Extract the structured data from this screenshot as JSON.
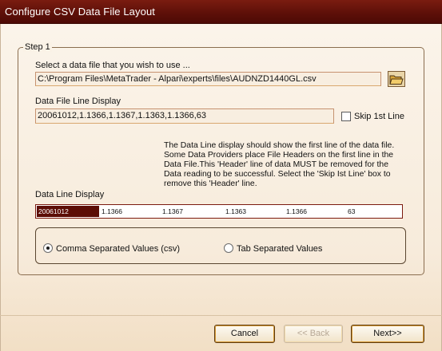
{
  "window": {
    "title": "Configure CSV Data File Layout"
  },
  "step": {
    "legend": "Step 1",
    "select_label": "Select a data file that you wish to use ...",
    "file_path": "C:\\Program Files\\MetaTrader - Alpari\\experts\\files\\AUDNZD1440GL.csv",
    "line_display_label": "Data File Line Display",
    "line_display_value": "20061012,1.1366,1.1367,1.1363,1.1366,63",
    "skip_label": "Skip 1st Line",
    "skip_checked": false,
    "info_lines": [
      "The Data Line display should show the first line of the data file.",
      "Some Data Providers place File Headers on the first line in the",
      "Data File.This 'Header' line of data MUST be removed for the",
      "Data reading to be successful. Select the 'Skip Ist Line' box to",
      "remove this 'Header'  line."
    ],
    "data_line_label": "Data Line Display",
    "data_cells": [
      "20061012",
      "1.1366",
      "1.1367",
      "1.1363",
      "1.1366",
      "63"
    ],
    "separator": {
      "csv_label": "Comma Separated Values (csv)",
      "tab_label": "Tab Separated Values",
      "selected": "csv"
    }
  },
  "buttons": {
    "cancel": "Cancel",
    "back": "<< Back",
    "next": "Next>>"
  },
  "colors": {
    "title_bar": "#5c0f08",
    "accent_cell": "#5c0d05",
    "button_accent": "#d79a34"
  }
}
